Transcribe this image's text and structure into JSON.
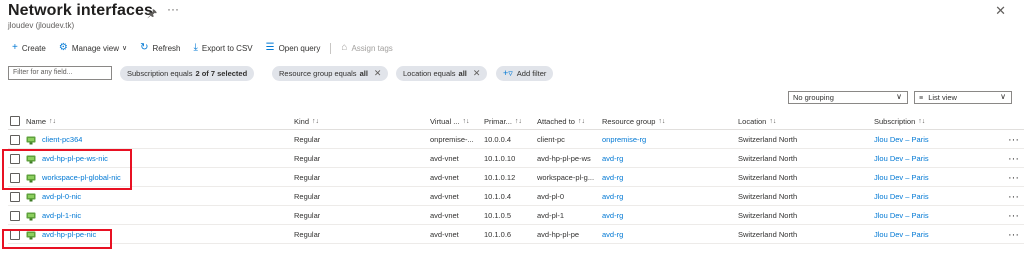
{
  "header": {
    "title": "Network interfaces",
    "subtitle": "jloudev (jloudev.tk)"
  },
  "toolbar": {
    "create": "Create",
    "manage_view": "Manage view",
    "refresh": "Refresh",
    "export_csv": "Export to CSV",
    "open_query": "Open query",
    "assign_tags": "Assign tags"
  },
  "filters": {
    "search_placeholder": "Filter for any field...",
    "subscription": {
      "label": "Subscription equals",
      "value": "2 of 7 selected"
    },
    "resource_group": {
      "label": "Resource group equals",
      "value": "all"
    },
    "location": {
      "label": "Location equals",
      "value": "all"
    },
    "add_filter": "Add filter"
  },
  "view": {
    "grouping": "No grouping",
    "list_view": "List view"
  },
  "columns": {
    "name": "Name",
    "kind": "Kind",
    "virtual": "Virtual ...",
    "primary": "Primar...",
    "attached": "Attached to",
    "rg": "Resource group",
    "location": "Location",
    "subscription": "Subscription"
  },
  "rows": [
    {
      "name": "client-pc364",
      "kind": "Regular",
      "vnet": "onpremise-...",
      "ip": "10.0.0.4",
      "attached": "client-pc",
      "rg": "onpremise-rg",
      "location": "Switzerland North",
      "sub": "Jlou Dev – Paris"
    },
    {
      "name": "avd-hp-pl-pe-ws-nic",
      "kind": "Regular",
      "vnet": "avd-vnet",
      "ip": "10.1.0.10",
      "attached": "avd-hp-pl-pe-ws",
      "rg": "avd-rg",
      "location": "Switzerland North",
      "sub": "Jlou Dev – Paris"
    },
    {
      "name": "workspace-pl-global-nic",
      "kind": "Regular",
      "vnet": "avd-vnet",
      "ip": "10.1.0.12",
      "attached": "workspace-pl-g...",
      "rg": "avd-rg",
      "location": "Switzerland North",
      "sub": "Jlou Dev – Paris"
    },
    {
      "name": "avd-pl-0-nic",
      "kind": "Regular",
      "vnet": "avd-vnet",
      "ip": "10.1.0.4",
      "attached": "avd-pl-0",
      "rg": "avd-rg",
      "location": "Switzerland North",
      "sub": "Jlou Dev – Paris"
    },
    {
      "name": "avd-pl-1-nic",
      "kind": "Regular",
      "vnet": "avd-vnet",
      "ip": "10.1.0.5",
      "attached": "avd-pl-1",
      "rg": "avd-rg",
      "location": "Switzerland North",
      "sub": "Jlou Dev – Paris"
    },
    {
      "name": "avd-hp-pl-pe-nic",
      "kind": "Regular",
      "vnet": "avd-vnet",
      "ip": "10.1.0.6",
      "attached": "avd-hp-pl-pe",
      "rg": "avd-rg",
      "location": "Switzerland North",
      "sub": "Jlou Dev – Paris"
    }
  ],
  "colors": {
    "accent": "#0078d4",
    "highlight": "#e81123",
    "nic_icon": "#5ea13b"
  }
}
